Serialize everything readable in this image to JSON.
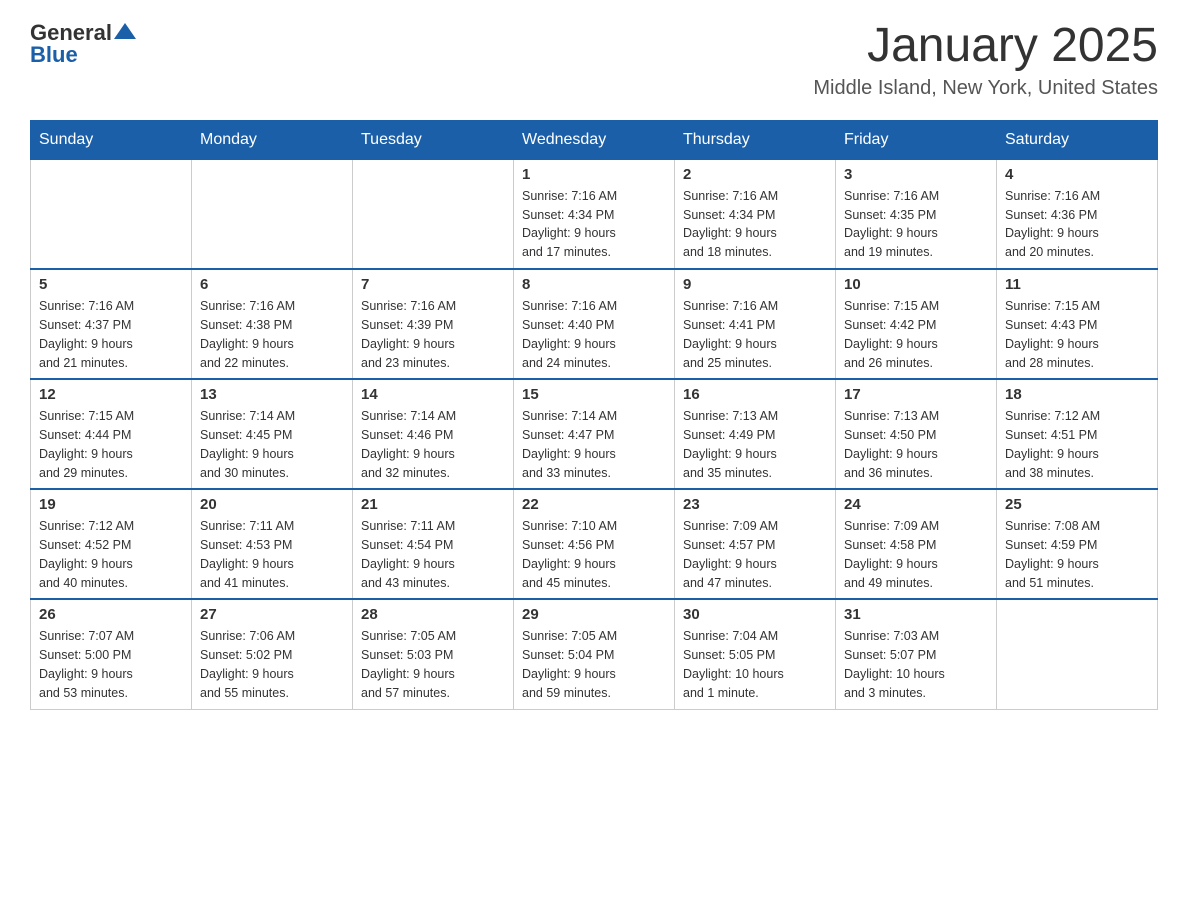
{
  "header": {
    "logo": {
      "text_general": "General",
      "text_blue": "Blue",
      "triangle_symbol": "▲"
    },
    "title": "January 2025",
    "location": "Middle Island, New York, United States"
  },
  "weekdays": [
    "Sunday",
    "Monday",
    "Tuesday",
    "Wednesday",
    "Thursday",
    "Friday",
    "Saturday"
  ],
  "weeks": [
    [
      {
        "day": "",
        "info": ""
      },
      {
        "day": "",
        "info": ""
      },
      {
        "day": "",
        "info": ""
      },
      {
        "day": "1",
        "info": "Sunrise: 7:16 AM\nSunset: 4:34 PM\nDaylight: 9 hours\nand 17 minutes."
      },
      {
        "day": "2",
        "info": "Sunrise: 7:16 AM\nSunset: 4:34 PM\nDaylight: 9 hours\nand 18 minutes."
      },
      {
        "day": "3",
        "info": "Sunrise: 7:16 AM\nSunset: 4:35 PM\nDaylight: 9 hours\nand 19 minutes."
      },
      {
        "day": "4",
        "info": "Sunrise: 7:16 AM\nSunset: 4:36 PM\nDaylight: 9 hours\nand 20 minutes."
      }
    ],
    [
      {
        "day": "5",
        "info": "Sunrise: 7:16 AM\nSunset: 4:37 PM\nDaylight: 9 hours\nand 21 minutes."
      },
      {
        "day": "6",
        "info": "Sunrise: 7:16 AM\nSunset: 4:38 PM\nDaylight: 9 hours\nand 22 minutes."
      },
      {
        "day": "7",
        "info": "Sunrise: 7:16 AM\nSunset: 4:39 PM\nDaylight: 9 hours\nand 23 minutes."
      },
      {
        "day": "8",
        "info": "Sunrise: 7:16 AM\nSunset: 4:40 PM\nDaylight: 9 hours\nand 24 minutes."
      },
      {
        "day": "9",
        "info": "Sunrise: 7:16 AM\nSunset: 4:41 PM\nDaylight: 9 hours\nand 25 minutes."
      },
      {
        "day": "10",
        "info": "Sunrise: 7:15 AM\nSunset: 4:42 PM\nDaylight: 9 hours\nand 26 minutes."
      },
      {
        "day": "11",
        "info": "Sunrise: 7:15 AM\nSunset: 4:43 PM\nDaylight: 9 hours\nand 28 minutes."
      }
    ],
    [
      {
        "day": "12",
        "info": "Sunrise: 7:15 AM\nSunset: 4:44 PM\nDaylight: 9 hours\nand 29 minutes."
      },
      {
        "day": "13",
        "info": "Sunrise: 7:14 AM\nSunset: 4:45 PM\nDaylight: 9 hours\nand 30 minutes."
      },
      {
        "day": "14",
        "info": "Sunrise: 7:14 AM\nSunset: 4:46 PM\nDaylight: 9 hours\nand 32 minutes."
      },
      {
        "day": "15",
        "info": "Sunrise: 7:14 AM\nSunset: 4:47 PM\nDaylight: 9 hours\nand 33 minutes."
      },
      {
        "day": "16",
        "info": "Sunrise: 7:13 AM\nSunset: 4:49 PM\nDaylight: 9 hours\nand 35 minutes."
      },
      {
        "day": "17",
        "info": "Sunrise: 7:13 AM\nSunset: 4:50 PM\nDaylight: 9 hours\nand 36 minutes."
      },
      {
        "day": "18",
        "info": "Sunrise: 7:12 AM\nSunset: 4:51 PM\nDaylight: 9 hours\nand 38 minutes."
      }
    ],
    [
      {
        "day": "19",
        "info": "Sunrise: 7:12 AM\nSunset: 4:52 PM\nDaylight: 9 hours\nand 40 minutes."
      },
      {
        "day": "20",
        "info": "Sunrise: 7:11 AM\nSunset: 4:53 PM\nDaylight: 9 hours\nand 41 minutes."
      },
      {
        "day": "21",
        "info": "Sunrise: 7:11 AM\nSunset: 4:54 PM\nDaylight: 9 hours\nand 43 minutes."
      },
      {
        "day": "22",
        "info": "Sunrise: 7:10 AM\nSunset: 4:56 PM\nDaylight: 9 hours\nand 45 minutes."
      },
      {
        "day": "23",
        "info": "Sunrise: 7:09 AM\nSunset: 4:57 PM\nDaylight: 9 hours\nand 47 minutes."
      },
      {
        "day": "24",
        "info": "Sunrise: 7:09 AM\nSunset: 4:58 PM\nDaylight: 9 hours\nand 49 minutes."
      },
      {
        "day": "25",
        "info": "Sunrise: 7:08 AM\nSunset: 4:59 PM\nDaylight: 9 hours\nand 51 minutes."
      }
    ],
    [
      {
        "day": "26",
        "info": "Sunrise: 7:07 AM\nSunset: 5:00 PM\nDaylight: 9 hours\nand 53 minutes."
      },
      {
        "day": "27",
        "info": "Sunrise: 7:06 AM\nSunset: 5:02 PM\nDaylight: 9 hours\nand 55 minutes."
      },
      {
        "day": "28",
        "info": "Sunrise: 7:05 AM\nSunset: 5:03 PM\nDaylight: 9 hours\nand 57 minutes."
      },
      {
        "day": "29",
        "info": "Sunrise: 7:05 AM\nSunset: 5:04 PM\nDaylight: 9 hours\nand 59 minutes."
      },
      {
        "day": "30",
        "info": "Sunrise: 7:04 AM\nSunset: 5:05 PM\nDaylight: 10 hours\nand 1 minute."
      },
      {
        "day": "31",
        "info": "Sunrise: 7:03 AM\nSunset: 5:07 PM\nDaylight: 10 hours\nand 3 minutes."
      },
      {
        "day": "",
        "info": ""
      }
    ]
  ]
}
